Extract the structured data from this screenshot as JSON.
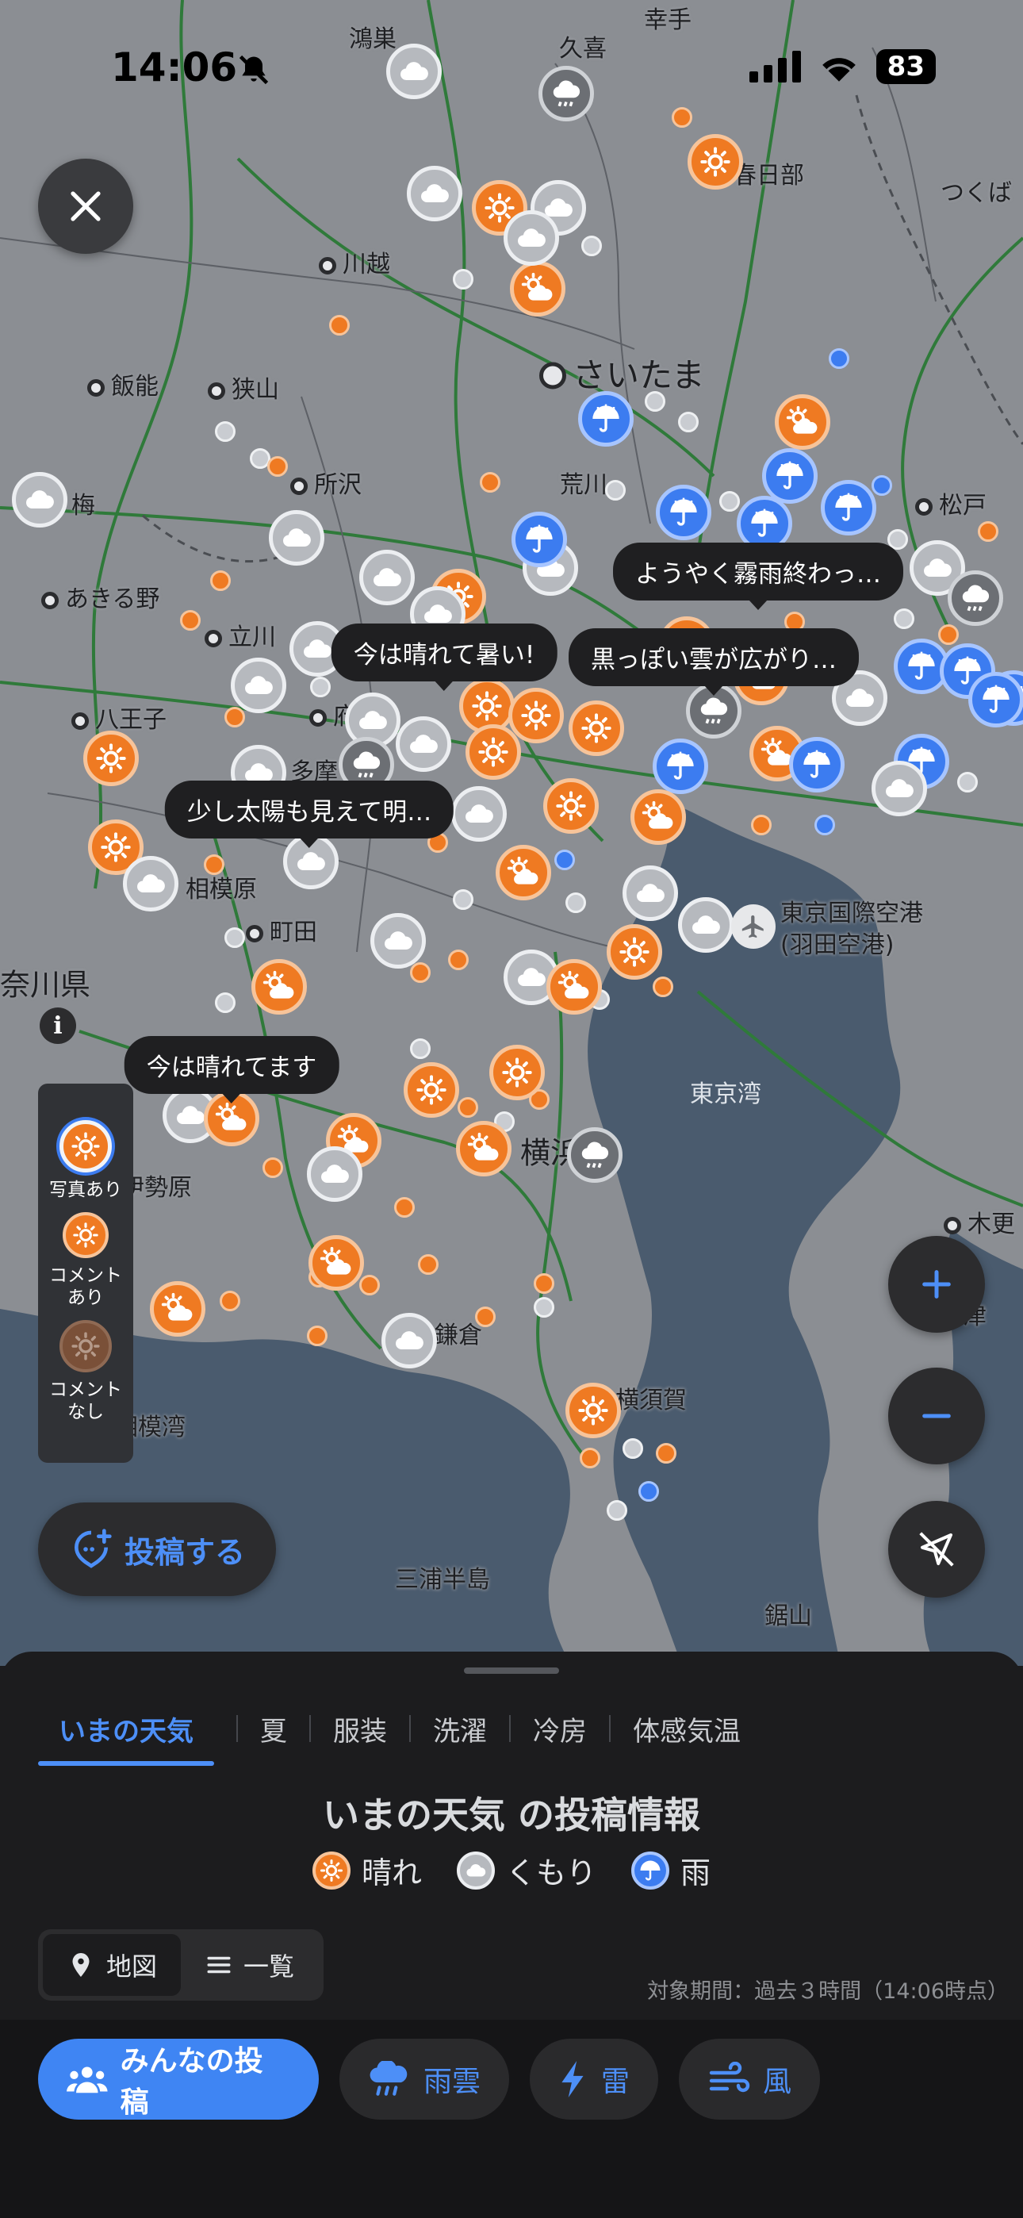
{
  "status_bar": {
    "time": "14:06",
    "battery": "83"
  },
  "map": {
    "places": [
      {
        "name": "鴻巣"
      },
      {
        "name": "久喜"
      },
      {
        "name": "幸手"
      },
      {
        "name": "春日部"
      },
      {
        "name": "つくば"
      },
      {
        "name": "川越"
      },
      {
        "name": "飯能"
      },
      {
        "name": "狭山"
      },
      {
        "name": "さいたま"
      },
      {
        "name": "所沢"
      },
      {
        "name": "荒川"
      },
      {
        "name": "松戸"
      },
      {
        "name": "梅"
      },
      {
        "name": "あきる野"
      },
      {
        "name": "立川"
      },
      {
        "name": "八王子"
      },
      {
        "name": "府"
      },
      {
        "name": "多摩"
      },
      {
        "name": "相模原"
      },
      {
        "name": "町田"
      },
      {
        "name": "奈川県"
      },
      {
        "name": "東京国際空港"
      },
      {
        "name": "(羽田空港)"
      },
      {
        "name": "東京湾"
      },
      {
        "name": "伊勢原"
      },
      {
        "name": "横浜"
      },
      {
        "name": "木更"
      },
      {
        "name": "鎌倉"
      },
      {
        "name": "津"
      },
      {
        "name": "横須賀"
      },
      {
        "name": "相模湾"
      },
      {
        "name": "三浦半島"
      },
      {
        "name": "鋸山"
      }
    ],
    "bubbles": [
      {
        "text": "ようやく霧雨終わっ…"
      },
      {
        "text": "今は晴れて暑い!"
      },
      {
        "text": "黒っぽい雲が広がり…"
      },
      {
        "text": "少し太陽も見えて明…"
      },
      {
        "text": "今は晴れてます"
      }
    ],
    "legend": {
      "photo": "写真あり",
      "comment": "コメント\nあり",
      "no_comment": "コメント\nなし"
    },
    "info": "i",
    "post_button": "投稿する"
  },
  "sheet": {
    "tabs": [
      {
        "label": "いまの天気",
        "active": true
      },
      {
        "label": "夏"
      },
      {
        "label": "服装"
      },
      {
        "label": "洗濯"
      },
      {
        "label": "冷房"
      },
      {
        "label": "体感気温"
      }
    ],
    "title": "いまの天気 の投稿情報",
    "weather_legend": [
      {
        "label": "晴れ",
        "icon": "sun-icon"
      },
      {
        "label": "くもり",
        "icon": "cloud-icon"
      },
      {
        "label": "雨",
        "icon": "umbrella-icon"
      }
    ],
    "view_toggle": [
      {
        "label": "地図",
        "icon": "pin-icon",
        "active": true
      },
      {
        "label": "一覧",
        "icon": "list-icon"
      }
    ],
    "period": "対象期間：過去３時間（14:06時点）"
  },
  "bottom_nav": [
    {
      "label": "みんなの投稿",
      "icon": "people-icon",
      "active": true
    },
    {
      "label": "雨雲",
      "icon": "rain-cloud-icon"
    },
    {
      "label": "雷",
      "icon": "lightning-icon"
    },
    {
      "label": "風",
      "icon": "wind-icon"
    }
  ],
  "colors": {
    "accent": "#4d8ff7",
    "sunny": "#ef7a22",
    "cloudy": "#b6b9be",
    "rain": "#3c7cf0",
    "water": "#4a5b6e",
    "land": "#8a8d92"
  }
}
